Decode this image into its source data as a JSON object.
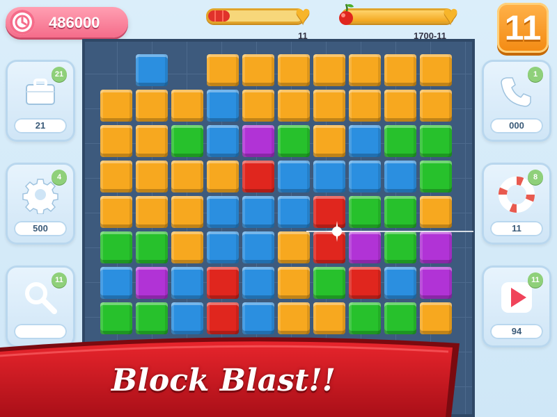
{
  "hud": {
    "score": "486000",
    "moves_bar": {
      "fill": 0.26,
      "caption": "11"
    },
    "target_bar": {
      "fill": 1.0,
      "caption": "1700-11"
    },
    "level": "11"
  },
  "left_panel": [
    {
      "name": "briefcase",
      "icon": "briefcase-icon",
      "badge": "21",
      "count": "21"
    },
    {
      "name": "gear",
      "icon": "gear-icon",
      "badge": "4",
      "count": "500"
    },
    {
      "name": "magnifier",
      "icon": "magnifier-icon",
      "badge": "11",
      "count": ""
    }
  ],
  "right_panel": [
    {
      "name": "phone",
      "icon": "phone-icon",
      "badge": "1",
      "count": "000"
    },
    {
      "name": "lifebuoy",
      "icon": "lifebuoy-icon",
      "badge": "8",
      "count": "11"
    },
    {
      "name": "play",
      "icon": "play-icon",
      "badge": "11",
      "count": "94"
    }
  ],
  "colors": {
    "O": "#f7a81f",
    "B": "#2b8fe0",
    "G": "#27c12c",
    "P": "#b133d6",
    "R": "#e0261e"
  },
  "board_rows": [
    "-B OOOOOOO-",
    "OOOBOOOOOO",
    "OOGBPGOBGG",
    "OOOORBBBBG",
    "OOOBBBRGGO",
    "GGOBBORPGP",
    "BPBRBOGRBP",
    "GGBRBOOGGO"
  ],
  "banner": {
    "title": "Block Blast!!"
  }
}
